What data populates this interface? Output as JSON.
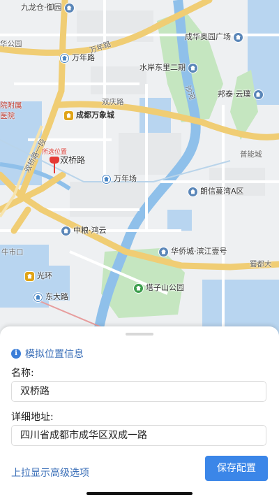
{
  "map": {
    "poi_labels": [
      {
        "id": "jiulonggang",
        "text": "九龙仓·御园",
        "kind": "gov"
      },
      {
        "id": "chenghua-olympic",
        "text": "成华奥园广场",
        "kind": "gov"
      },
      {
        "id": "wannianlu-station",
        "text": "万年路",
        "kind": "bus"
      },
      {
        "id": "shuian",
        "text": "水岸东里二期",
        "kind": "gov"
      },
      {
        "id": "bangtai",
        "text": "邦泰·云璞",
        "kind": "gov"
      },
      {
        "id": "wanxiangcheng",
        "text": "成都万象城",
        "kind": "mall"
      },
      {
        "id": "shuangqiao",
        "text": "双桥路",
        "kind": "none"
      },
      {
        "id": "wannianchang",
        "text": "万年场",
        "kind": "bus"
      },
      {
        "id": "langxin",
        "text": "朗信蔓湾A区",
        "kind": "gov"
      },
      {
        "id": "zhongliang",
        "text": "中粮·鸿云",
        "kind": "gov"
      },
      {
        "id": "huaqiao",
        "text": "华侨城·滨江壹号",
        "kind": "gov"
      },
      {
        "id": "guanghuan",
        "text": "光环",
        "kind": "mall"
      },
      {
        "id": "tazishan",
        "text": "塔子山公园",
        "kind": "park"
      },
      {
        "id": "dongdalu",
        "text": "东大路",
        "kind": "bus"
      }
    ],
    "road_labels": {
      "wannian": "万年路",
      "shuangqing": "双庆路",
      "shuangqiao_yi": "双桥路一段",
      "shajiang": "沙河",
      "jinneng": "普能城",
      "hudai": "蜀都大",
      "niushikou": "牛市口",
      "huachi": "华公园",
      "hospital": "院附属医院"
    },
    "marker": {
      "label": "所选位置"
    }
  },
  "sheet": {
    "title": "模拟位置信息",
    "name_label": "名称:",
    "name_value": "双桥路",
    "address_label": "详细地址:",
    "address_value": "四川省成都市成华区双成一路",
    "advanced_link": "上拉显示高级选项",
    "save_button": "保存配置"
  },
  "colors": {
    "accent": "#3b86e8",
    "link": "#3b6fb8",
    "marker": "#e53935",
    "main_road": "#f3d37a",
    "river": "#7fb8e8",
    "park": "#b8dfb0"
  }
}
